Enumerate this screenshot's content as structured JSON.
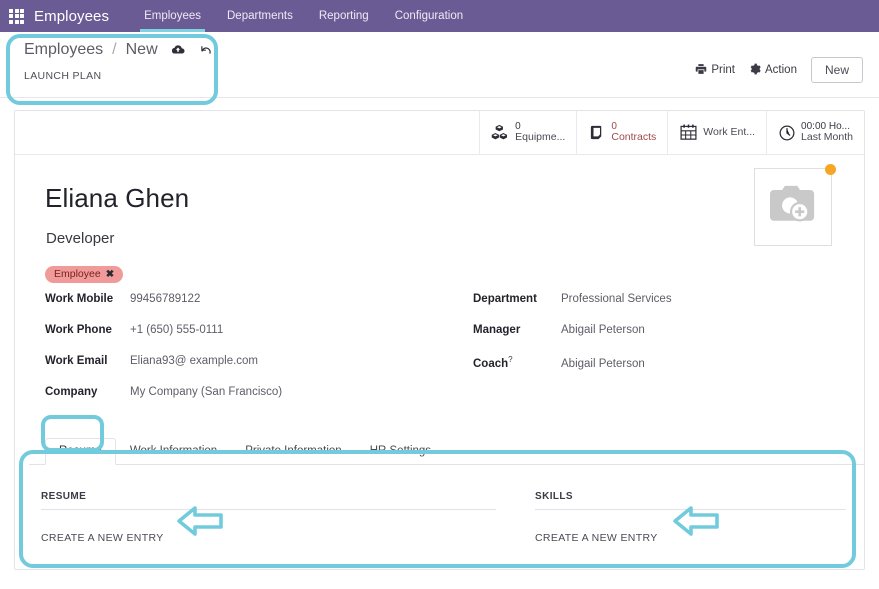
{
  "navbar": {
    "apps_icon": "apps-grid-icon",
    "brand": "Employees",
    "menu": [
      {
        "label": "Employees",
        "active": true
      },
      {
        "label": "Departments",
        "active": false
      },
      {
        "label": "Reporting",
        "active": false
      },
      {
        "label": "Configuration",
        "active": false
      }
    ]
  },
  "control_panel": {
    "breadcrumb_root": "Employees",
    "breadcrumb_sep": "/",
    "breadcrumb_current": "New",
    "save_icon": "cloud-upload-icon",
    "discard_icon": "undo-arrow-icon",
    "launch_plan_label": "LAUNCH PLAN",
    "print_label": "Print",
    "print_icon": "printer-icon",
    "action_label": "Action",
    "action_icon": "gear-icon",
    "new_button_label": "New"
  },
  "stat_buttons": [
    {
      "icon": "cubes-icon",
      "value": "0",
      "label": "Equipme...",
      "accent": "#3a3a44"
    },
    {
      "icon": "book-icon",
      "value": "0",
      "label": "Contracts",
      "accent": "#a04a4a"
    },
    {
      "icon": "calendar-icon",
      "value": "",
      "label": "Work Ent...",
      "accent": "#3a3a44"
    },
    {
      "icon": "clock-icon",
      "value": "00:00 Ho...",
      "label": "Last Month",
      "accent": "#3a3a44"
    }
  ],
  "employee": {
    "name": "Eliana Ghen",
    "job_title": "Developer",
    "tag": "Employee",
    "tag_remove": "✖",
    "avatar_icon": "camera-add-icon",
    "avatar_status_dot_color": "#f5a623",
    "left_fields": [
      {
        "label": "Work Mobile",
        "value": "99456789122"
      },
      {
        "label": "Work Phone",
        "value": "+1 (650) 555-0111"
      },
      {
        "label": "Work Email",
        "value": "Eliana93@ example.com"
      },
      {
        "label": "Company",
        "value": "My Company (San Francisco)"
      }
    ],
    "right_fields": [
      {
        "label": "Department",
        "value": "Professional Services",
        "help": ""
      },
      {
        "label": "Manager",
        "value": "Abigail Peterson",
        "help": ""
      },
      {
        "label": "Coach",
        "value": "Abigail Peterson",
        "help": "?"
      }
    ]
  },
  "notebook": {
    "tabs": [
      {
        "label": "Resume",
        "active": true
      },
      {
        "label": "Work Information",
        "active": false
      },
      {
        "label": "Private Information",
        "active": false
      },
      {
        "label": "HR Settings",
        "active": false
      }
    ],
    "panels": [
      {
        "title": "RESUME",
        "link": "CREATE A NEW ENTRY"
      },
      {
        "title": "SKILLS",
        "link": "CREATE A NEW ENTRY"
      }
    ]
  },
  "annotations": {
    "highlight_color": "#72cbdd",
    "arrow_icon": "left-arrow-annotation",
    "highlighted_regions": [
      "breadcrumb-area",
      "resume-tab",
      "resume-skills-panel"
    ]
  },
  "colors": {
    "navbar_bg": "#6b5b95",
    "navbar_active_underline": "#7fd3e0",
    "tag_bg": "#f09a9a",
    "tag_text": "#7a2020",
    "contracts_accent": "#a04a4a"
  }
}
